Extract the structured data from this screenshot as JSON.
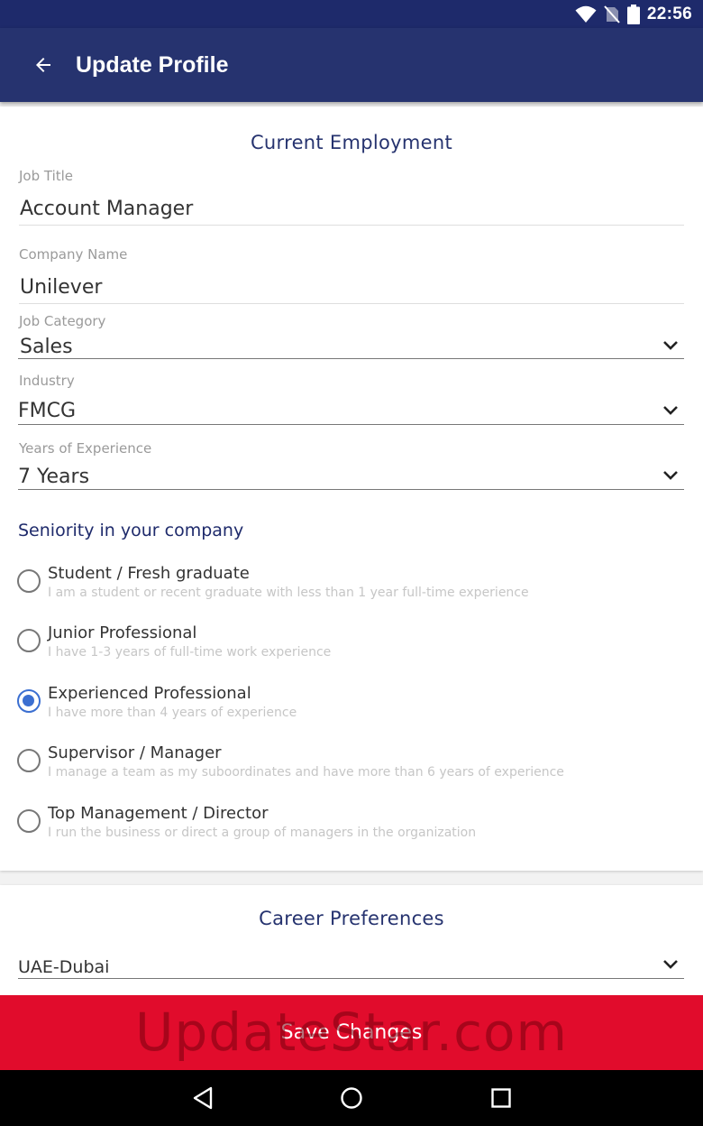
{
  "status_bar": {
    "time": "22:56"
  },
  "app_bar": {
    "title": "Update Profile"
  },
  "employment": {
    "section_title": "Current Employment",
    "job_title": {
      "label": "Job Title",
      "value": "Account Manager"
    },
    "company_name": {
      "label": "Company Name",
      "value": "Unilever"
    },
    "job_category": {
      "label": "Job Category",
      "value": "Sales"
    },
    "industry": {
      "label": "Industry",
      "value": "FMCG"
    },
    "years_experience": {
      "label": "Years of Experience",
      "value": "7 Years"
    },
    "seniority": {
      "title": "Seniority in your company",
      "options": [
        {
          "title": "Student / Fresh graduate",
          "desc": "I am a student or recent graduate with less than 1 year full-time experience",
          "selected": false
        },
        {
          "title": "Junior Professional",
          "desc": "I have 1-3 years of full-time work experience",
          "selected": false
        },
        {
          "title": "Experienced Professional",
          "desc": "I have more than 4 years of experience",
          "selected": true
        },
        {
          "title": "Supervisor / Manager",
          "desc": "I manage a team as my suboordinates and have more than 6 years of experience",
          "selected": false
        },
        {
          "title": "Top Management / Director",
          "desc": "I run the business or direct a group of managers in the organization",
          "selected": false
        }
      ]
    }
  },
  "career": {
    "section_title": "Career Preferences",
    "location": {
      "value": "UAE-Dubai"
    }
  },
  "save_button": {
    "label": "Save Changes"
  },
  "watermark": {
    "text": "UpdateStar.com"
  },
  "colors": {
    "app_bar": "#26336f",
    "save_button": "#e10c2c",
    "radio_selected": "#3b6fd1"
  }
}
